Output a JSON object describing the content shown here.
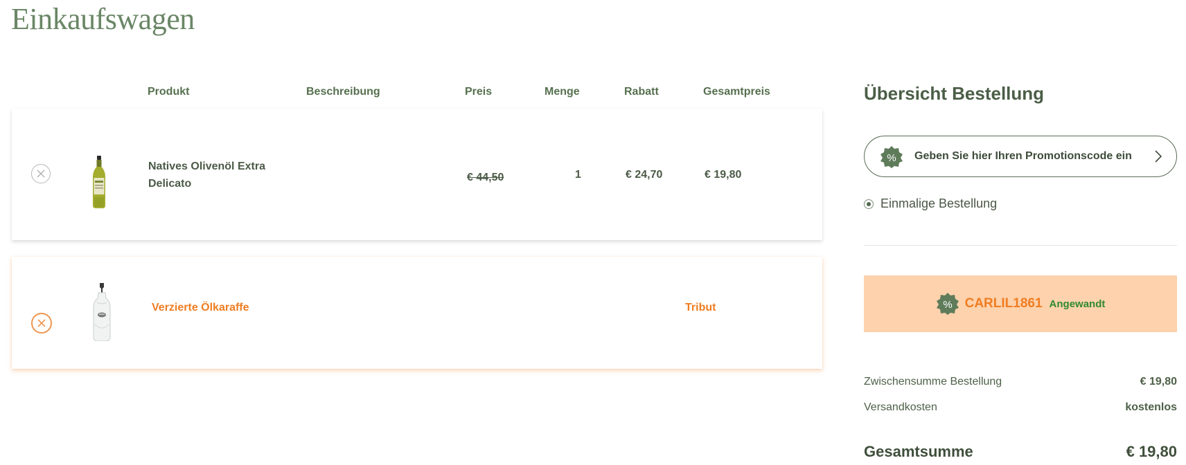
{
  "page": {
    "title": "Einkaufswagen"
  },
  "table": {
    "headers": {
      "product": "Produkt",
      "description": "Beschreibung",
      "price": "Preis",
      "quantity": "Menge",
      "discount": "Rabatt",
      "total": "Gesamtpreis"
    },
    "items": [
      {
        "name": "Natives Olivenöl Extra Delicato",
        "price": "€ 44,50",
        "quantity": "1",
        "discount": "€ 24,70",
        "total": "€ 19,80"
      },
      {
        "name": "Verzierte Ölkaraffe",
        "total": "Tribut"
      }
    ]
  },
  "summary": {
    "title": "Übersicht Bestellung",
    "promo_placeholder": "Geben Sie hier Ihren Promotionscode ein",
    "order_type": "Einmalige Bestellung",
    "applied_code": "CARLIL1861",
    "applied_status": "Angewandt",
    "subtotal_label": "Zwischensumme Bestellung",
    "subtotal_value": "€ 19,80",
    "shipping_label": "Versandkosten",
    "shipping_value": "kostenlos",
    "total_label": "Gesamtsumme",
    "total_value": "€ 19,80"
  },
  "colors": {
    "brand_green": "#6a8666",
    "accent_orange": "#ef7d22",
    "applied_bg": "#fdd2ad",
    "applied_green": "#2f8a2f"
  },
  "icons": {
    "remove": "close-circle-icon",
    "promo": "percent-badge-icon",
    "chevron": "chevron-right-icon"
  }
}
